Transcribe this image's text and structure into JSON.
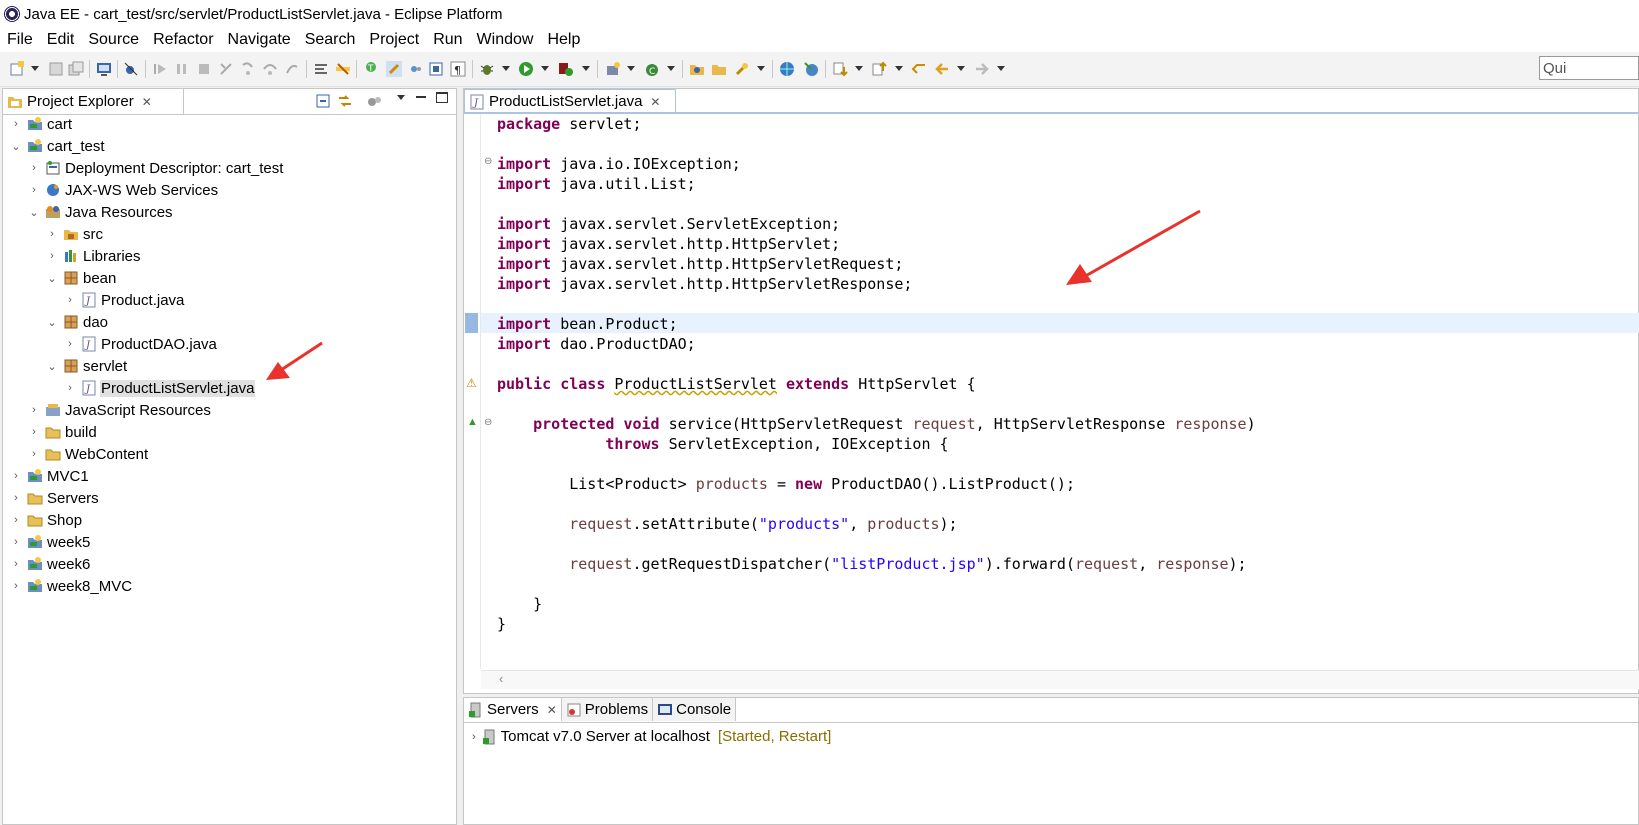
{
  "window": {
    "title": "Java EE - cart_test/src/servlet/ProductListServlet.java - Eclipse Platform"
  },
  "menu": [
    {
      "label": "File",
      "u": "F",
      "rest": "ile"
    },
    {
      "label": "Edit",
      "u": "E",
      "rest": "dit"
    },
    {
      "label": "Source",
      "u": "S",
      "rest": "ource"
    },
    {
      "label": "Refactor",
      "u": "",
      "rest": "Refactor",
      "u2": "t"
    },
    {
      "label": "Navigate",
      "u": "N",
      "rest": "avigate"
    },
    {
      "label": "Search",
      "u": "",
      "rest": "Search",
      "u3": "a"
    },
    {
      "label": "Project",
      "u": "P",
      "rest": "roject"
    },
    {
      "label": "Run",
      "u": "R",
      "rest": "un"
    },
    {
      "label": "Window",
      "u": "W",
      "rest": "indow"
    },
    {
      "label": "Help",
      "u": "H",
      "rest": "elp"
    }
  ],
  "quick_access": {
    "placeholder": "Qui"
  },
  "project_explorer": {
    "title": "Project Explorer",
    "tree": [
      {
        "label": "cart",
        "depth": 0,
        "expanded": false,
        "icon": "project-icon"
      },
      {
        "label": "cart_test",
        "depth": 0,
        "expanded": true,
        "icon": "project-icon"
      },
      {
        "label": "Deployment Descriptor: cart_test",
        "depth": 1,
        "expanded": false,
        "icon": "deployment-descriptor-icon"
      },
      {
        "label": "JAX-WS Web Services",
        "depth": 1,
        "expanded": false,
        "icon": "web-services-icon"
      },
      {
        "label": "Java Resources",
        "depth": 1,
        "expanded": true,
        "icon": "java-resources-icon"
      },
      {
        "label": "src",
        "depth": 2,
        "expanded": false,
        "icon": "source-folder-icon"
      },
      {
        "label": "Libraries",
        "depth": 2,
        "expanded": false,
        "icon": "libraries-icon"
      },
      {
        "label": "bean",
        "depth": 2,
        "expanded": true,
        "icon": "package-icon"
      },
      {
        "label": "Product.java",
        "depth": 3,
        "expanded": false,
        "icon": "java-file-icon"
      },
      {
        "label": "dao",
        "depth": 2,
        "expanded": true,
        "icon": "package-icon"
      },
      {
        "label": "ProductDAO.java",
        "depth": 3,
        "expanded": false,
        "icon": "java-file-icon"
      },
      {
        "label": "servlet",
        "depth": 2,
        "expanded": true,
        "icon": "package-icon"
      },
      {
        "label": "ProductListServlet.java",
        "depth": 3,
        "expanded": false,
        "icon": "java-file-icon",
        "selected": true
      },
      {
        "label": "JavaScript Resources",
        "depth": 1,
        "expanded": false,
        "icon": "javascript-resources-icon"
      },
      {
        "label": "build",
        "depth": 1,
        "expanded": false,
        "icon": "folder-icon"
      },
      {
        "label": "WebContent",
        "depth": 1,
        "expanded": false,
        "icon": "folder-icon"
      },
      {
        "label": "MVC1",
        "depth": 0,
        "expanded": false,
        "icon": "project-icon"
      },
      {
        "label": "Servers",
        "depth": 0,
        "expanded": false,
        "icon": "folder-icon"
      },
      {
        "label": "Shop",
        "depth": 0,
        "expanded": false,
        "icon": "folder-icon"
      },
      {
        "label": "week5",
        "depth": 0,
        "expanded": false,
        "icon": "project-icon"
      },
      {
        "label": "week6",
        "depth": 0,
        "expanded": false,
        "icon": "project-icon"
      },
      {
        "label": "week8_MVC",
        "depth": 0,
        "expanded": false,
        "icon": "project-icon"
      }
    ]
  },
  "editor": {
    "tab_label": "ProductListServlet.java",
    "lines": [
      [
        [
          "kw",
          "package"
        ],
        [
          "t",
          " servlet;"
        ]
      ],
      [],
      [
        [
          "kw",
          "import"
        ],
        [
          "t",
          " java.io.IOException;"
        ]
      ],
      [
        [
          "kw",
          "import"
        ],
        [
          "t",
          " java.util.List;"
        ]
      ],
      [],
      [
        [
          "kw",
          "import"
        ],
        [
          "t",
          " javax.servlet.ServletException;"
        ]
      ],
      [
        [
          "kw",
          "import"
        ],
        [
          "t",
          " javax.servlet.http.HttpServlet;"
        ]
      ],
      [
        [
          "kw",
          "import"
        ],
        [
          "t",
          " javax.servlet.http.HttpServletRequest;"
        ]
      ],
      [
        [
          "kw",
          "import"
        ],
        [
          "t",
          " javax.servlet.http.HttpServletResponse;"
        ]
      ],
      [],
      [
        [
          "kw",
          "import"
        ],
        [
          "t",
          " bean.Product;"
        ]
      ],
      [
        [
          "kw",
          "import"
        ],
        [
          "t",
          " dao.ProductDAO;"
        ]
      ],
      [],
      [
        [
          "kw",
          "public"
        ],
        [
          "t",
          " "
        ],
        [
          "kw",
          "class"
        ],
        [
          "t",
          " "
        ],
        [
          "warn",
          "ProductListServlet"
        ],
        [
          "t",
          " "
        ],
        [
          "kw",
          "extends"
        ],
        [
          "t",
          " HttpServlet {"
        ]
      ],
      [],
      [
        [
          "t",
          "    "
        ],
        [
          "kw",
          "protected"
        ],
        [
          "t",
          " "
        ],
        [
          "kw",
          "void"
        ],
        [
          "t",
          " service(HttpServletRequest "
        ],
        [
          "param",
          "request"
        ],
        [
          "t",
          ", HttpServletResponse "
        ],
        [
          "param",
          "response"
        ],
        [
          "t",
          ")"
        ]
      ],
      [
        [
          "t",
          "            "
        ],
        [
          "kw",
          "throws"
        ],
        [
          "t",
          " ServletException, IOException {"
        ]
      ],
      [],
      [
        [
          "t",
          "        List<Product> "
        ],
        [
          "param",
          "products"
        ],
        [
          "t",
          " = "
        ],
        [
          "kw",
          "new"
        ],
        [
          "t",
          " ProductDAO().ListProduct();"
        ]
      ],
      [],
      [
        [
          "t",
          "        "
        ],
        [
          "param",
          "request"
        ],
        [
          "t",
          ".setAttribute("
        ],
        [
          "str",
          "\"products\""
        ],
        [
          "t",
          ", "
        ],
        [
          "param",
          "products"
        ],
        [
          "t",
          ");"
        ]
      ],
      [],
      [
        [
          "t",
          "        "
        ],
        [
          "param",
          "request"
        ],
        [
          "t",
          ".getRequestDispatcher("
        ],
        [
          "str",
          "\"listProduct.jsp\""
        ],
        [
          "t",
          ").forward("
        ],
        [
          "param",
          "request"
        ],
        [
          "t",
          ", "
        ],
        [
          "param",
          "response"
        ],
        [
          "t",
          ");"
        ]
      ],
      [],
      [
        [
          "t",
          "    }"
        ]
      ],
      [
        [
          "t",
          "}"
        ]
      ]
    ]
  },
  "bottom_panel": {
    "tabs": [
      {
        "label": "Servers",
        "icon": "servers-icon",
        "active": true
      },
      {
        "label": "Problems",
        "icon": "problems-icon",
        "active": false
      },
      {
        "label": "Console",
        "icon": "console-icon",
        "active": false
      }
    ],
    "server": {
      "name": "Tomcat v7.0 Server at localhost",
      "status": "[Started, Restart]"
    }
  },
  "colors": {
    "keyword": "#7f0055",
    "string": "#2a00ff",
    "param": "#6a3e3e",
    "annotation_arrow": "#e8322b",
    "selection": "#e0e0e0"
  }
}
